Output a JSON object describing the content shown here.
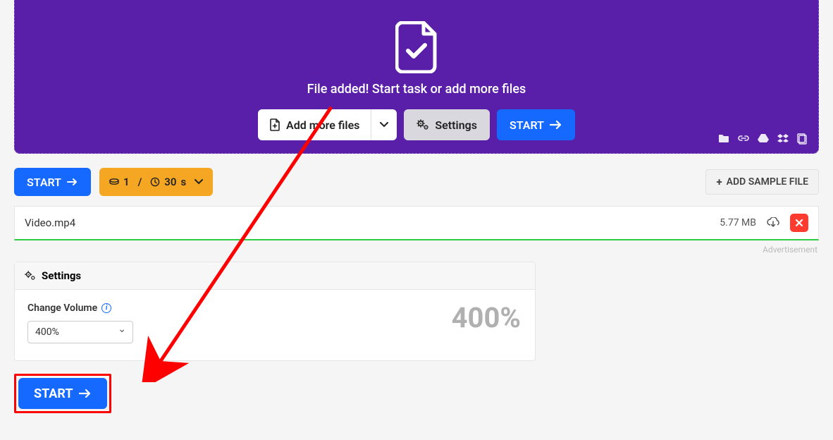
{
  "hero": {
    "message": "File added! Start task or add more files",
    "add_more_label": "Add more files",
    "settings_label": "Settings",
    "start_label": "START"
  },
  "toolbar": {
    "start_label": "START",
    "batch_count": "1",
    "batch_sep": "/",
    "batch_time_value": "30",
    "batch_time_unit": "s",
    "add_sample_label": "ADD SAMPLE FILE"
  },
  "file": {
    "name": "Video.mp4",
    "size": "5.77 MB"
  },
  "ad_label": "Advertisement",
  "settings": {
    "panel_title": "Settings",
    "change_volume_label": "Change Volume",
    "change_volume_value": "400%",
    "change_volume_display": "400%"
  },
  "bottom": {
    "start_label": "START"
  }
}
